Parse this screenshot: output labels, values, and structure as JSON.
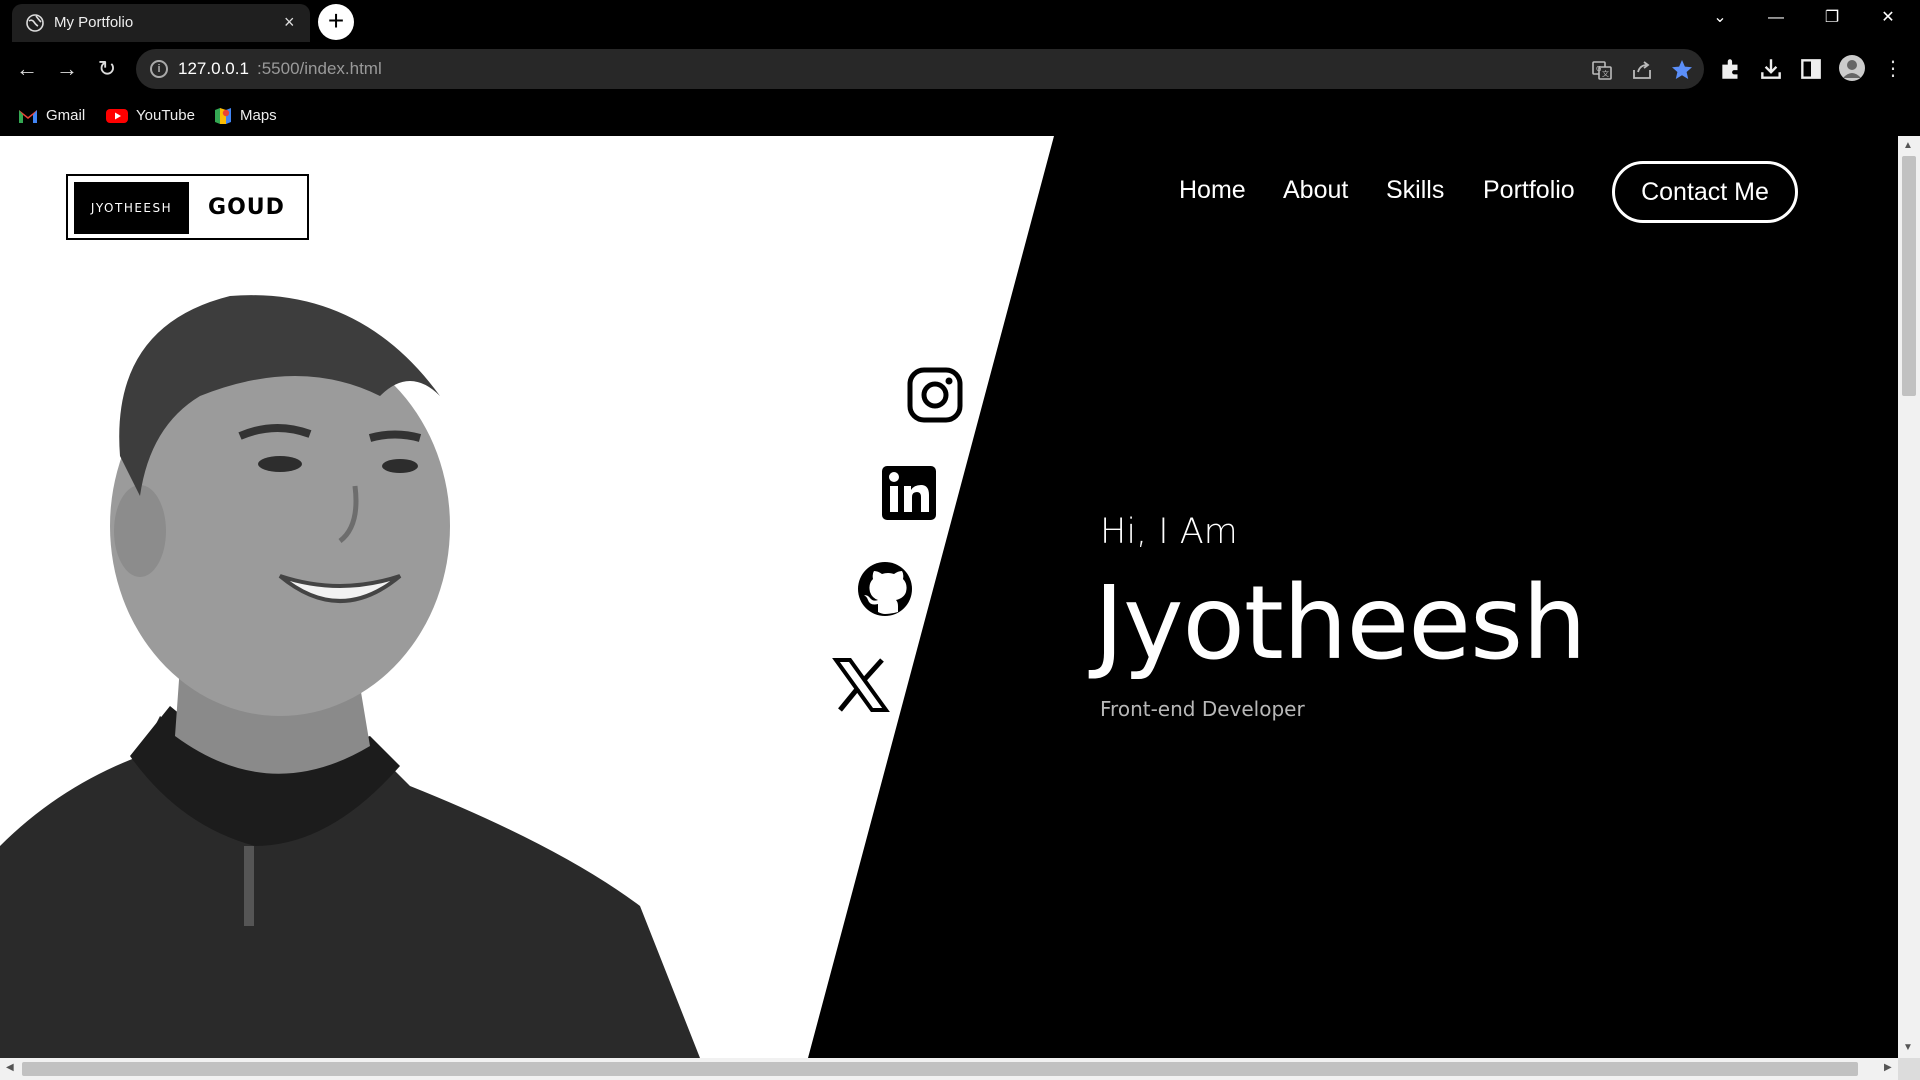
{
  "browser": {
    "tab_title": "My Portfolio",
    "tab_close": "×",
    "new_tab": "+",
    "url_host": "127.0.0.1",
    "url_path": ":5500/index.html",
    "bookmarks": [
      {
        "label": "Gmail",
        "icon": "gmail-icon"
      },
      {
        "label": "YouTube",
        "icon": "youtube-icon"
      },
      {
        "label": "Maps",
        "icon": "maps-icon"
      }
    ],
    "window_controls": {
      "tab_search": "⌄",
      "minimize": "—",
      "restore": "❐",
      "close": "✕"
    },
    "nav": {
      "back": "←",
      "forward": "→",
      "reload": "↻"
    },
    "accent_color": "#3b82f6"
  },
  "page": {
    "logo": {
      "first": "JYOTHEESH",
      "last": "GOUD"
    },
    "nav_links": [
      "Home",
      "About",
      "Skills",
      "Portfolio"
    ],
    "contact_button": "Contact Me",
    "hero": {
      "greeting": "Hi, I Am",
      "name": "Jyotheesh",
      "role": "Front-end Developer"
    },
    "social_icons": [
      "instagram-icon",
      "linkedin-icon",
      "github-icon",
      "x-icon"
    ],
    "colors": {
      "background": "#000000",
      "panel": "#ffffff",
      "muted_text": "#b8b8b8"
    }
  }
}
